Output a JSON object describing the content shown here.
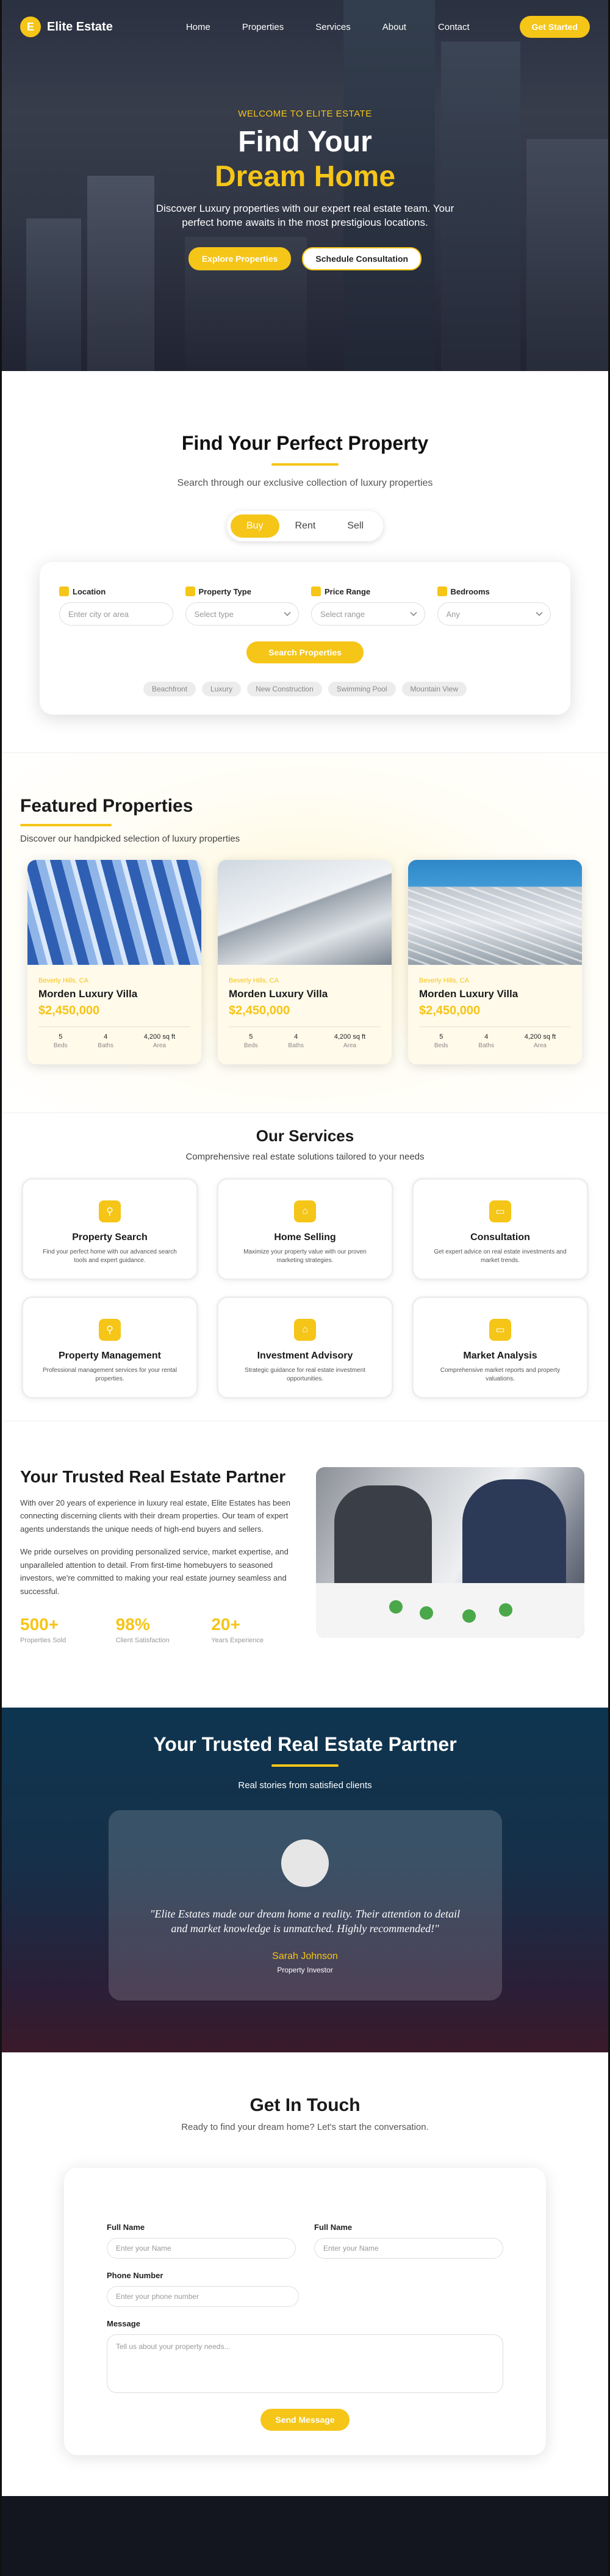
{
  "nav": {
    "logo_letter": "E",
    "brand": "Elite Estate",
    "links": [
      "Home",
      "Properties",
      "Services",
      "About",
      "Contact"
    ],
    "cta": "Get Started"
  },
  "hero": {
    "eyebrow": "WELCOME TO ELITE ESTATE",
    "title_line1": "Find Your",
    "title_line2": "Dream Home",
    "description": "Discover Luxury properties with our expert real estate team. Your perfect home awaits in the most prestigious locations.",
    "btn_primary": "Explore Properties",
    "btn_secondary": "Schedule Consultation"
  },
  "search": {
    "title": "Find Your Perfect Property",
    "subtitle": "Search through our exclusive collection of luxury properties",
    "tabs": [
      "Buy",
      "Rent",
      "Sell"
    ],
    "active_tab": "Buy",
    "fields": [
      {
        "label": "Location",
        "placeholder": "Enter city or area"
      },
      {
        "label": "Property Type",
        "placeholder": "Select type"
      },
      {
        "label": "Price Range",
        "placeholder": "Select range"
      },
      {
        "label": "Bedrooms",
        "placeholder": "Any"
      }
    ],
    "button": "Search Properties",
    "tags": [
      "Beachfront",
      "Luxury",
      "New Construction",
      "Swimming Pool",
      "Mountain View"
    ]
  },
  "featured": {
    "title": "Featured Properties",
    "subtitle": "Discover our handpicked selection of luxury properties",
    "cards": [
      {
        "location": "Beverly Hills, CA",
        "name": "Morden Luxury Villa",
        "price": "$2,450,000",
        "beds": "5",
        "beds_label": "Beds",
        "baths": "4",
        "baths_label": "Baths",
        "area": "4,200 sq ft",
        "area_label": "Area"
      },
      {
        "location": "Beverly Hills, CA",
        "name": "Morden Luxury Villa",
        "price": "$2,450,000",
        "beds": "5",
        "beds_label": "Beds",
        "baths": "4",
        "baths_label": "Baths",
        "area": "4,200 sq ft",
        "area_label": "Area"
      },
      {
        "location": "Beverly Hills, CA",
        "name": "Morden Luxury Villa",
        "price": "$2,450,000",
        "beds": "5",
        "beds_label": "Beds",
        "baths": "4",
        "baths_label": "Baths",
        "area": "4,200 sq ft",
        "area_label": "Area"
      }
    ]
  },
  "services": {
    "title": "Our Services",
    "subtitle": "Comprehensive real estate solutions tailored to your needs",
    "items": [
      {
        "icon": "search-icon",
        "name": "Property Search",
        "desc": "Find your perfect home with our advanced search tools and expert guidance."
      },
      {
        "icon": "home-icon",
        "name": "Home Selling",
        "desc": "Maximize your property value with our proven marketing strategies."
      },
      {
        "icon": "chat-icon",
        "name": "Consultation",
        "desc": "Get expert advice on real estate investments and market trends."
      },
      {
        "icon": "search-icon",
        "name": "Property Management",
        "desc": "Professional management services for your rental properties."
      },
      {
        "icon": "building-icon",
        "name": "Investment Advisory",
        "desc": "Strategic guidance for real estate investment opportunities."
      },
      {
        "icon": "chat-icon",
        "name": "Market Analysis",
        "desc": "Comprehensive market reports and property valuations."
      }
    ]
  },
  "about": {
    "title": "Your Trusted Real Estate Partner",
    "p1": "With over 20 years of experience in luxury real estate, Elite Estates has been connecting discerning clients with their dream properties. Our team of expert agents understands the unique needs of high-end buyers and sellers.",
    "p2": "We pride ourselves on providing personalized service, market expertise, and unparalleled attention to detail. From first-time homebuyers to seasoned investors, we're committed to making your real estate journey seamless and successful.",
    "stats": [
      {
        "value": "500+",
        "label": "Properties Sold"
      },
      {
        "value": "98%",
        "label": "Client Satisfaction"
      },
      {
        "value": "20+",
        "label": "Years Experience"
      }
    ]
  },
  "testimonial": {
    "title": "Your Trusted Real Estate Partner",
    "subtitle": "Real stories from satisfied clients",
    "quote": "\"Elite Estates made our dream home a reality. Their attention to detail and market knowledge is unmatched. Highly recommended!\"",
    "name": "Sarah Johnson",
    "role": "Property Investor"
  },
  "contact": {
    "title": "Get In Touch",
    "subtitle": "Ready to find your dream home? Let's start the conversation.",
    "field1_label": "Full Name",
    "field1_placeholder": "Enter your Name",
    "field2_label": "Full Name",
    "field2_placeholder": "Enter your Name",
    "phone_label": "Phone Number",
    "phone_placeholder": "Enter your phone number",
    "message_label": "Message",
    "message_placeholder": "Tell us about your property needs...",
    "send": "Send Message"
  },
  "colors": {
    "accent": "#f5c518",
    "dark": "#14161f"
  }
}
